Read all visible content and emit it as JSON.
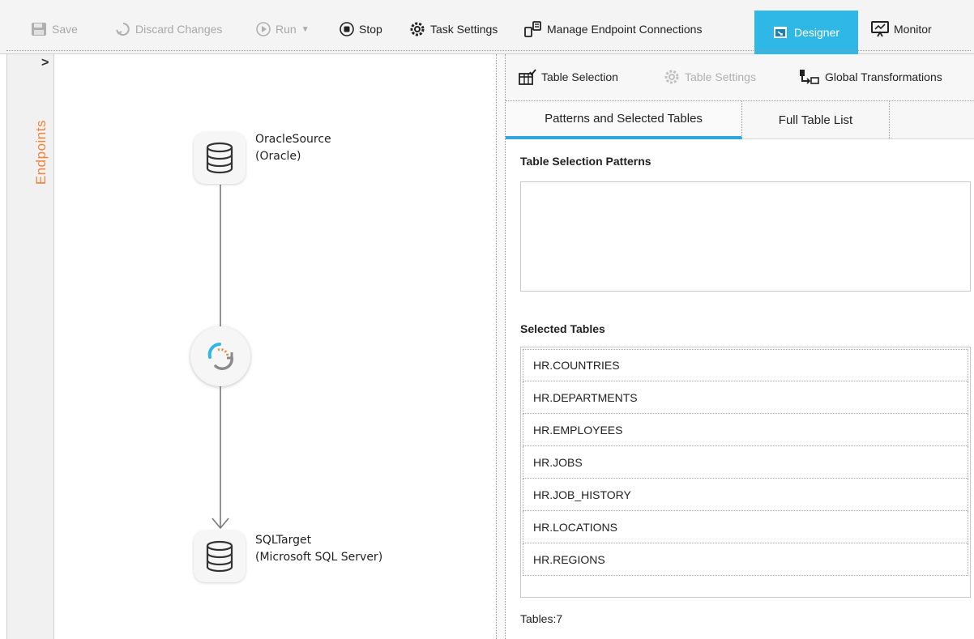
{
  "toolbar": {
    "save": "Save",
    "discard": "Discard Changes",
    "run": "Run",
    "stop": "Stop",
    "task_settings": "Task Settings",
    "manage_endpoints": "Manage Endpoint Connections",
    "designer": "Designer",
    "monitor": "Monitor"
  },
  "sidebar": {
    "expand_glyph": ">",
    "label": "Endpoints"
  },
  "diagram": {
    "source": {
      "name": "OracleSource",
      "type": "(Oracle)"
    },
    "target": {
      "name": "SQLTarget",
      "type": "(Microsoft SQL Server)"
    }
  },
  "right_toolbar": {
    "table_selection": "Table Selection",
    "table_settings": "Table Settings",
    "global_transformations": "Global Transformations"
  },
  "tabs": [
    {
      "label": "Patterns and Selected Tables",
      "active": true
    },
    {
      "label": "Full Table List",
      "active": false
    }
  ],
  "patterns": {
    "title": "Table Selection Patterns"
  },
  "selected": {
    "title": "Selected Tables",
    "rows": [
      "HR.COUNTRIES",
      "HR.DEPARTMENTS",
      "HR.EMPLOYEES",
      "HR.JOBS",
      "HR.JOB_HISTORY",
      "HR.LOCATIONS",
      "HR.REGIONS"
    ],
    "count": "Tables:7"
  },
  "colors": {
    "accent": "#2fb7e6",
    "endpoints": "#f0843c",
    "tab_underline": "#2fa6e0"
  }
}
